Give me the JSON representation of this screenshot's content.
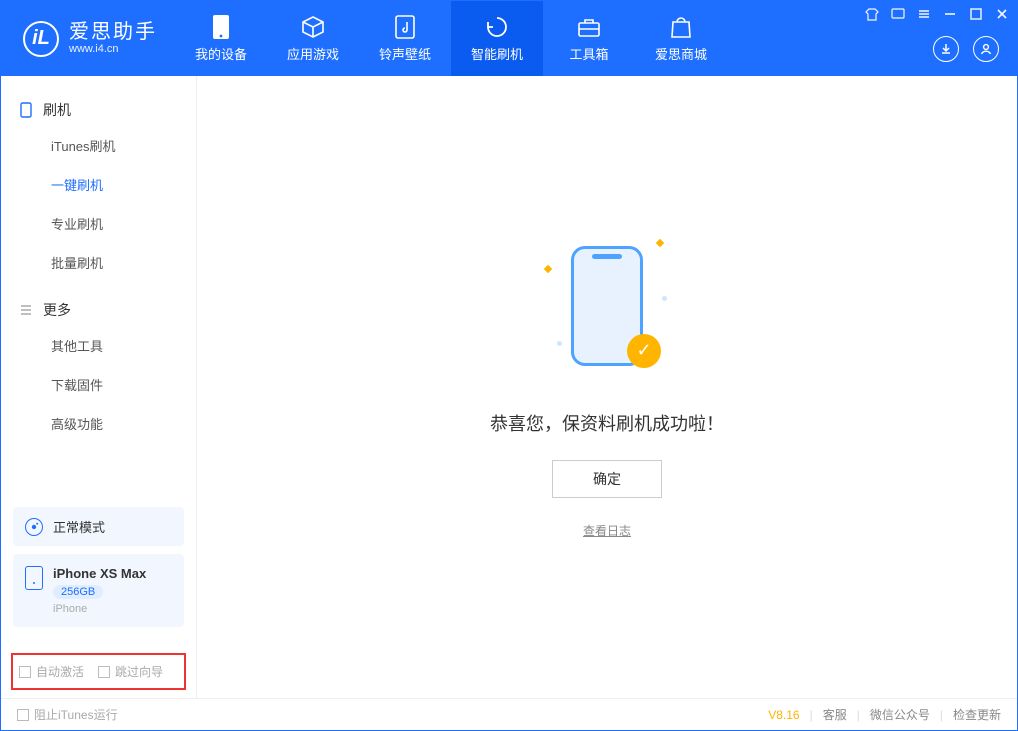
{
  "app": {
    "title": "爱思助手",
    "subtitle": "www.i4.cn",
    "logo_letter": "iL"
  },
  "tabs": {
    "my_device": "我的设备",
    "app_games": "应用游戏",
    "ring_wall": "铃声壁纸",
    "smart_flash": "智能刷机",
    "toolbox": "工具箱",
    "store": "爱思商城"
  },
  "sidebar": {
    "group_flash": {
      "title": "刷机",
      "items": [
        "iTunes刷机",
        "一键刷机",
        "专业刷机",
        "批量刷机"
      ]
    },
    "group_more": {
      "title": "更多",
      "items": [
        "其他工具",
        "下载固件",
        "高级功能"
      ]
    }
  },
  "mode_card": {
    "label": "正常模式"
  },
  "device_card": {
    "name": "iPhone XS Max",
    "capacity": "256GB",
    "type": "iPhone"
  },
  "shortcuts": {
    "auto_activate": "自动激活",
    "skip_wizard": "跳过向导"
  },
  "main": {
    "success_message": "恭喜您，保资料刷机成功啦！",
    "ok_button": "确定",
    "view_log": "查看日志"
  },
  "footer": {
    "block_itunes": "阻止iTunes运行",
    "version": "V8.16",
    "support": "客服",
    "wechat": "微信公众号",
    "check_update": "检查更新"
  }
}
